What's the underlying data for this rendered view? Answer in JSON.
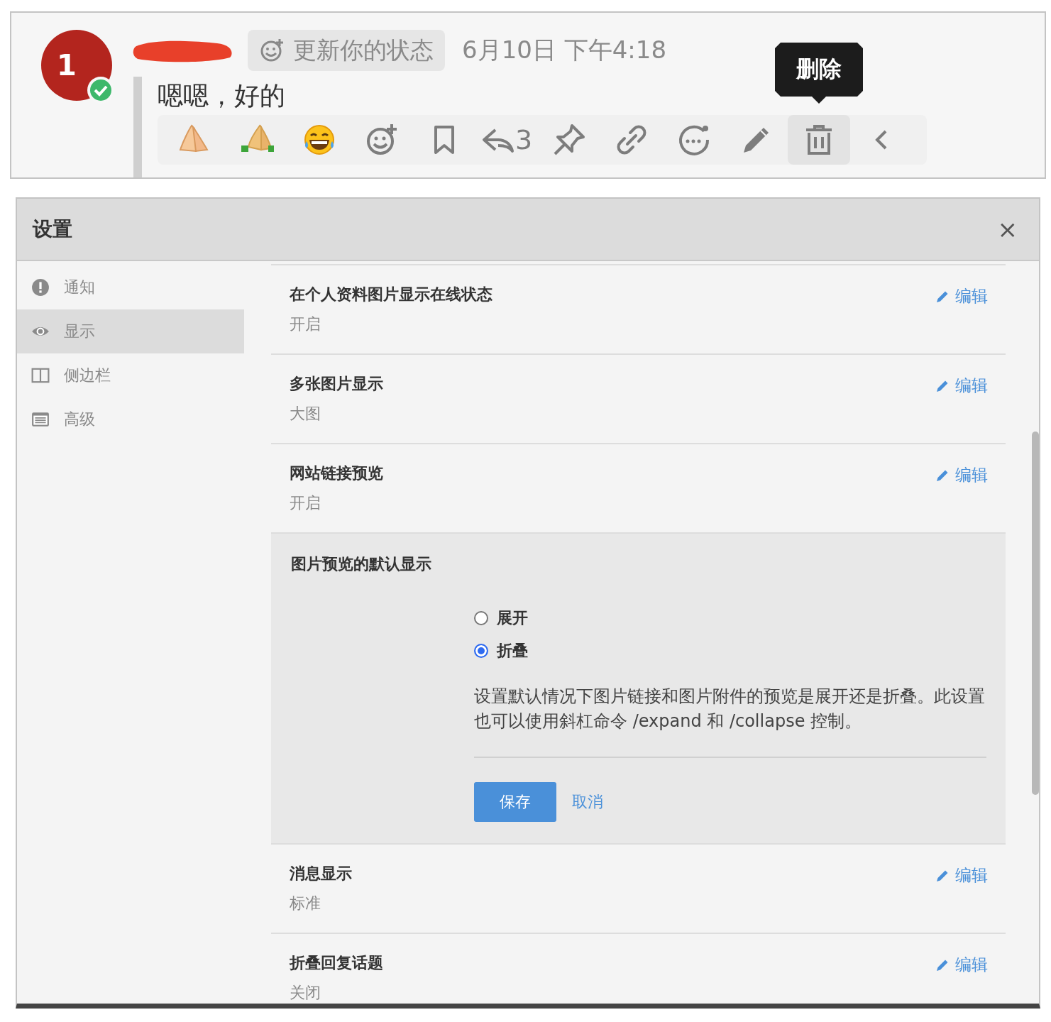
{
  "message": {
    "avatar": {
      "initial": "1",
      "online": true
    },
    "author_redacted": true,
    "status_button": "更新你的状态",
    "timestamp": "6月10日 下午4:18",
    "text": "嗯嗯，好的",
    "actions": [
      {
        "kind": "palms",
        "selected": false
      },
      {
        "kind": "palms-green",
        "selected": false
      },
      {
        "kind": "laughing",
        "selected": false
      },
      {
        "kind": "add-reaction",
        "selected": false
      },
      {
        "kind": "bookmark",
        "selected": false
      },
      {
        "kind": "reply",
        "count": "3",
        "selected": false
      },
      {
        "kind": "pin",
        "selected": false
      },
      {
        "kind": "link",
        "selected": false
      },
      {
        "kind": "more",
        "selected": false
      },
      {
        "kind": "edit",
        "selected": false
      },
      {
        "kind": "delete",
        "selected": true,
        "tooltip": "删除"
      },
      {
        "kind": "collapse",
        "selected": false
      }
    ]
  },
  "settings": {
    "title": "设置",
    "close": "×",
    "sidebar": {
      "items": [
        {
          "kind": "alert",
          "label": "通知",
          "selected": false
        },
        {
          "kind": "eye",
          "label": "显示",
          "selected": true
        },
        {
          "kind": "columns",
          "label": "侧边栏",
          "selected": false
        },
        {
          "kind": "list",
          "label": "高级",
          "selected": false
        }
      ]
    },
    "rows": [
      {
        "kind": "setting",
        "title": "在个人资料图片显示在线状态",
        "value": "开启",
        "edit": "编辑"
      },
      {
        "kind": "setting",
        "title": "多张图片显示",
        "value": "大图",
        "edit": "编辑"
      },
      {
        "kind": "setting",
        "title": "网站链接预览",
        "value": "开启",
        "edit": "编辑"
      },
      {
        "kind": "expanded",
        "title": "图片预览的默认显示",
        "options": [
          {
            "label": "展开",
            "selected": false
          },
          {
            "label": "折叠",
            "selected": true
          }
        ],
        "description": "设置默认情况下图片链接和图片附件的预览是展开还是折叠。此设置也可以使用斜杠命令 /expand 和 /collapse 控制。",
        "save": "保存",
        "cancel": "取消"
      },
      {
        "kind": "setting",
        "title": "消息显示",
        "value": "标准",
        "edit": "编辑"
      },
      {
        "kind": "setting",
        "title": "折叠回复话题",
        "value": "关闭",
        "edit": "编辑"
      }
    ]
  }
}
